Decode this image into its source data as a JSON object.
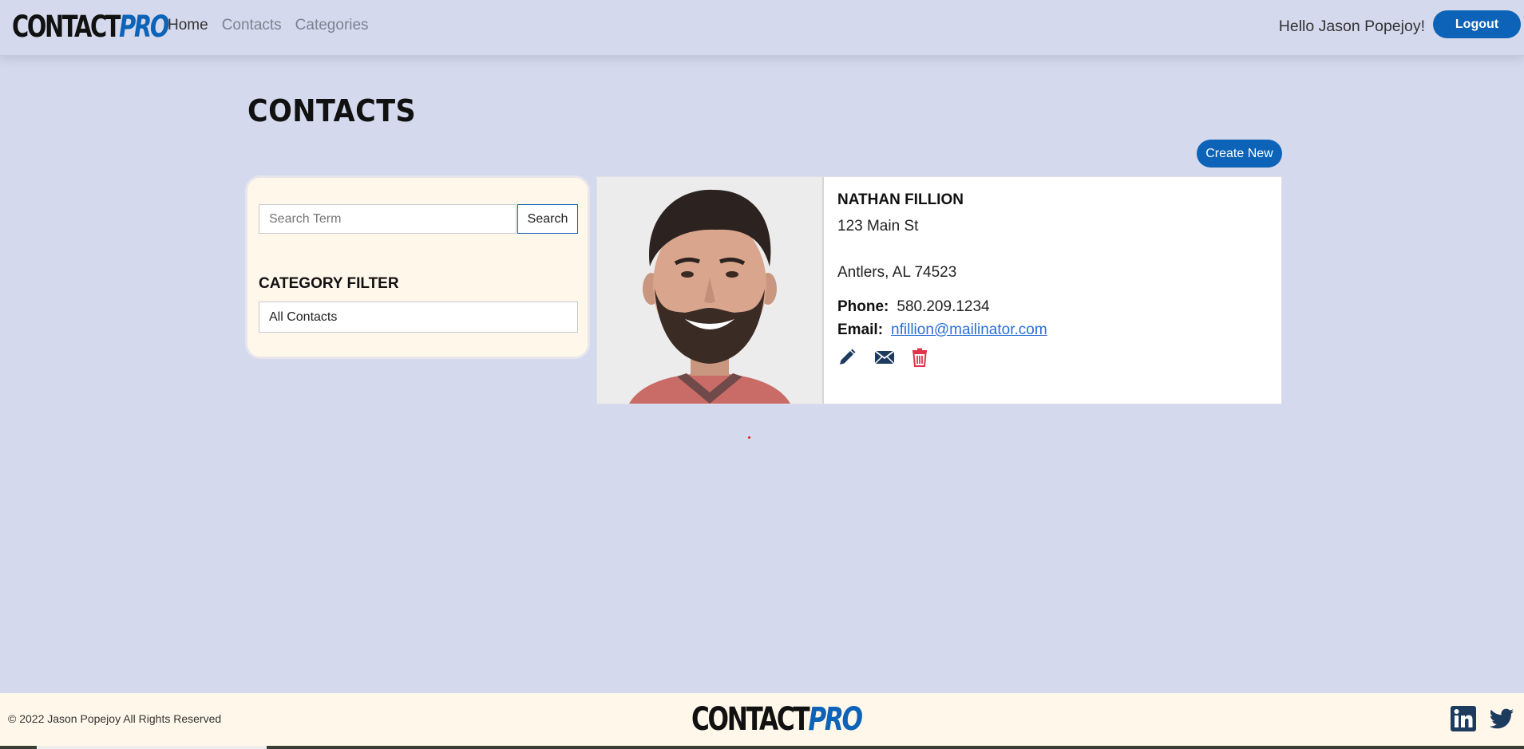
{
  "nav": {
    "brand_part1": "CONTACT",
    "brand_part2": "PRO",
    "links": [
      "Home",
      "Contacts",
      "Categories"
    ],
    "greeting": "Hello Jason Popejoy!",
    "logout_label": "Logout"
  },
  "main": {
    "title": "CONTACTS",
    "create_label": "Create New"
  },
  "filter": {
    "search_placeholder": "Search Term",
    "search_button": "Search",
    "category_label": "CATEGORY FILTER",
    "category_selected": "All Contacts"
  },
  "contact": {
    "name": "NATHAN FILLION",
    "address1": "123 Main St",
    "address2": "Antlers, AL 74523",
    "phone_label": "Phone:",
    "phone": "580.209.1234",
    "email_label": "Email:",
    "email": "nfillion@mailinator.com"
  },
  "footer": {
    "copyright": "© 2022 Jason Popejoy All Rights Reserved",
    "brand_part1": "CONTACT",
    "brand_part2": "PRO"
  },
  "colors": {
    "background": "#d5d9ed",
    "primary": "#0d63b7",
    "panel": "#fff7ea",
    "delete": "#e0344a",
    "icon_dark": "#1d3a5f"
  },
  "icons": [
    "pencil-icon",
    "envelope-icon",
    "trash-icon",
    "linkedin-icon",
    "twitter-icon"
  ]
}
